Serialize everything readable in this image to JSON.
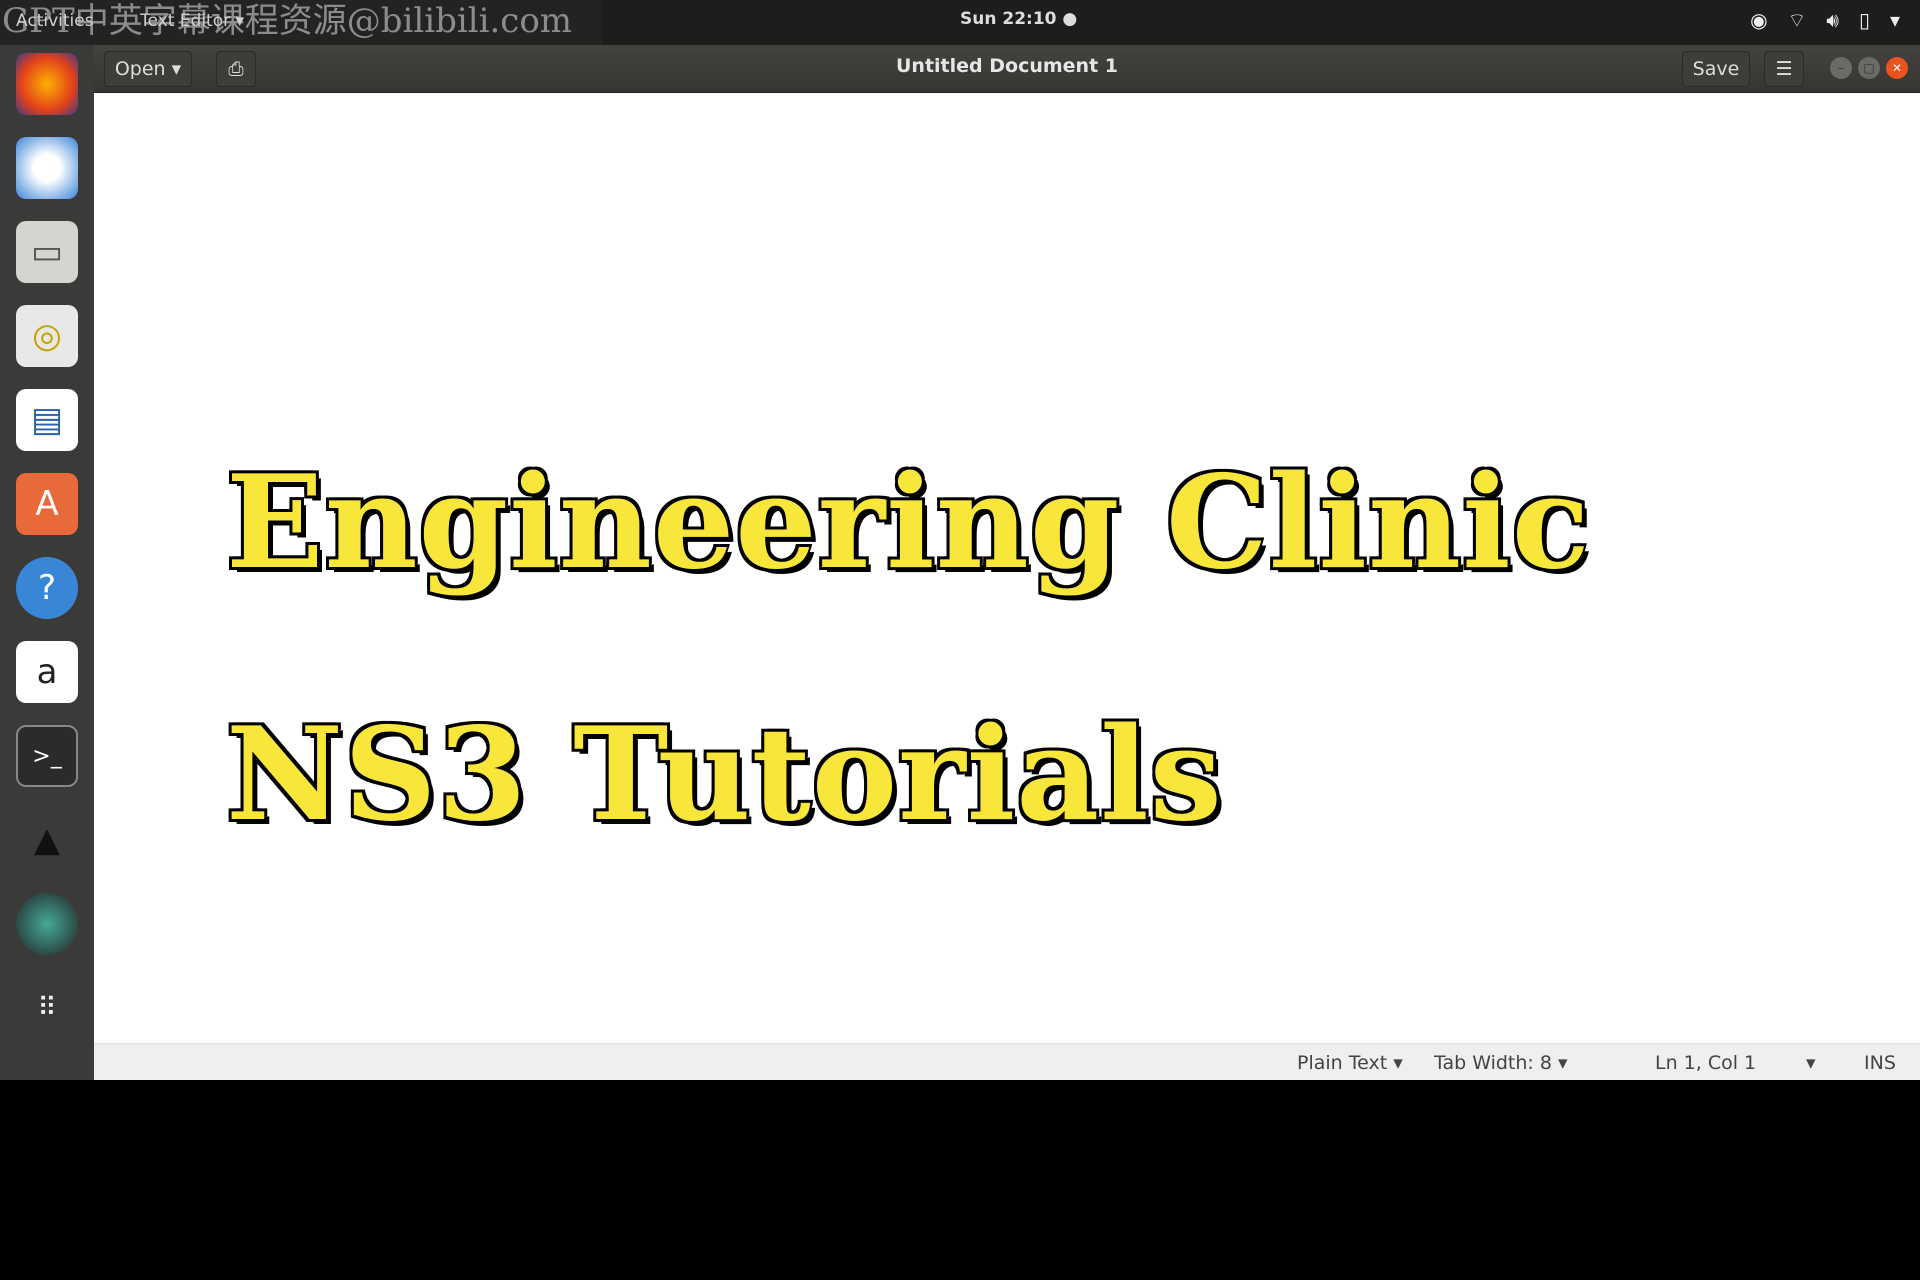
{
  "topbar": {
    "activities": "Activities",
    "app_menu": "Text Editor ▾",
    "watermark": "GPT中英字幕课程资源@bilibili.com",
    "clock": "Sun 22:10 ●"
  },
  "header": {
    "open_label": "Open ▾",
    "title": "Untitled Document 1",
    "save_label": "Save",
    "menu_icon": "☰"
  },
  "dock": {
    "items": [
      "firefox",
      "thunderbird",
      "files",
      "rhythmbox",
      "libreoffice-writer",
      "software-center",
      "help",
      "amazon",
      "terminal",
      "inkscape",
      "scanner",
      "show-apps"
    ]
  },
  "document": {
    "line1": "Engineering Clinic",
    "line2": "NS3 Tutorials"
  },
  "status": {
    "language": "Plain Text ▾",
    "tab_width": "Tab Width: 8 ▾",
    "position": "Ln 1, Col 1",
    "position_dropdown": "▾",
    "mode": "INS"
  },
  "colors": {
    "text_fill": "#f8e63a",
    "text_outline": "#000000",
    "close_button": "#e9541e"
  }
}
